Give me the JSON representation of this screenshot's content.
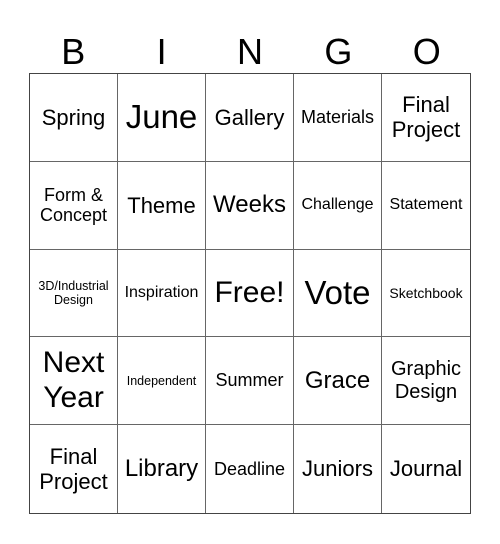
{
  "header": {
    "letters": [
      "B",
      "I",
      "N",
      "G",
      "O"
    ]
  },
  "cells": [
    {
      "text": "Spring",
      "size": "s22"
    },
    {
      "text": "June",
      "size": "s33"
    },
    {
      "text": "Gallery",
      "size": "s22"
    },
    {
      "text": "Materials",
      "size": "s18"
    },
    {
      "text": "Final Project",
      "size": "s22"
    },
    {
      "text": "Form & Concept",
      "size": "s18"
    },
    {
      "text": "Theme",
      "size": "s22"
    },
    {
      "text": "Weeks",
      "size": "s24"
    },
    {
      "text": "Challenge",
      "size": "s16"
    },
    {
      "text": "Statement",
      "size": "s16"
    },
    {
      "text": "3D/Industrial Design",
      "size": "s12"
    },
    {
      "text": "Inspiration",
      "size": "s16"
    },
    {
      "text": "Free!",
      "size": "s30"
    },
    {
      "text": "Vote",
      "size": "s33"
    },
    {
      "text": "Sketchbook",
      "size": "s14"
    },
    {
      "text": "Next Year",
      "size": "s30"
    },
    {
      "text": "Independent",
      "size": "s12"
    },
    {
      "text": "Summer",
      "size": "s18"
    },
    {
      "text": "Grace",
      "size": "s24"
    },
    {
      "text": "Graphic Design",
      "size": "s20"
    },
    {
      "text": "Final Project",
      "size": "s22"
    },
    {
      "text": "Library",
      "size": "s24"
    },
    {
      "text": "Deadline",
      "size": "s18"
    },
    {
      "text": "Juniors",
      "size": "s22"
    },
    {
      "text": "Journal",
      "size": "s22"
    }
  ]
}
